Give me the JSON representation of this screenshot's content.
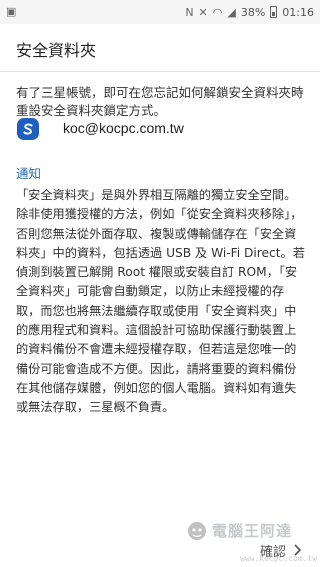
{
  "status_bar": {
    "battery": "38%",
    "time": "01:16"
  },
  "header": {
    "title": "安全資料夾"
  },
  "intro_text": "有了三星帳號，即可在您忘記如何解鎖安全資料夾時重設安全資料夾鎖定方式。",
  "account": {
    "email": "koc@kocpc.com.tw",
    "icon": "samsung-account-icon"
  },
  "notice": {
    "heading": "通知",
    "body": "「安全資料夾」是與外界相互隔離的獨立安全空間。除非使用獲授權的方法，例如「從安全資料夾移除」，否則您無法從外面存取、複製或傳輸儲存在「安全資料夾」中的資料，包括透過 USB 及 Wi-Fi Direct。若偵測到裝置已解開 Root 權限或安裝自訂 ROM，「安全資料夾」可能會自動鎖定，以防止未經授權的存取，而您也將無法繼續存取或使用「安全資料夾」中的應用程式和資料。這個設計可協助保護行動裝置上的資料備份不會遭未經授權存取，但若這是您唯一的備份可能會造成不方便。因此，請將重要的資料備份在其他儲存媒體，例如您的個人電腦。資料如有遺失或無法存取，三星概不負責。"
  },
  "footer": {
    "confirm_label": "確認"
  },
  "watermark": {
    "text": "電腦王阿達",
    "url": "www.kocpc.com.tw"
  },
  "colors": {
    "accent": "#2b6cb0",
    "account_icon_bg": "#1f5fbf"
  }
}
